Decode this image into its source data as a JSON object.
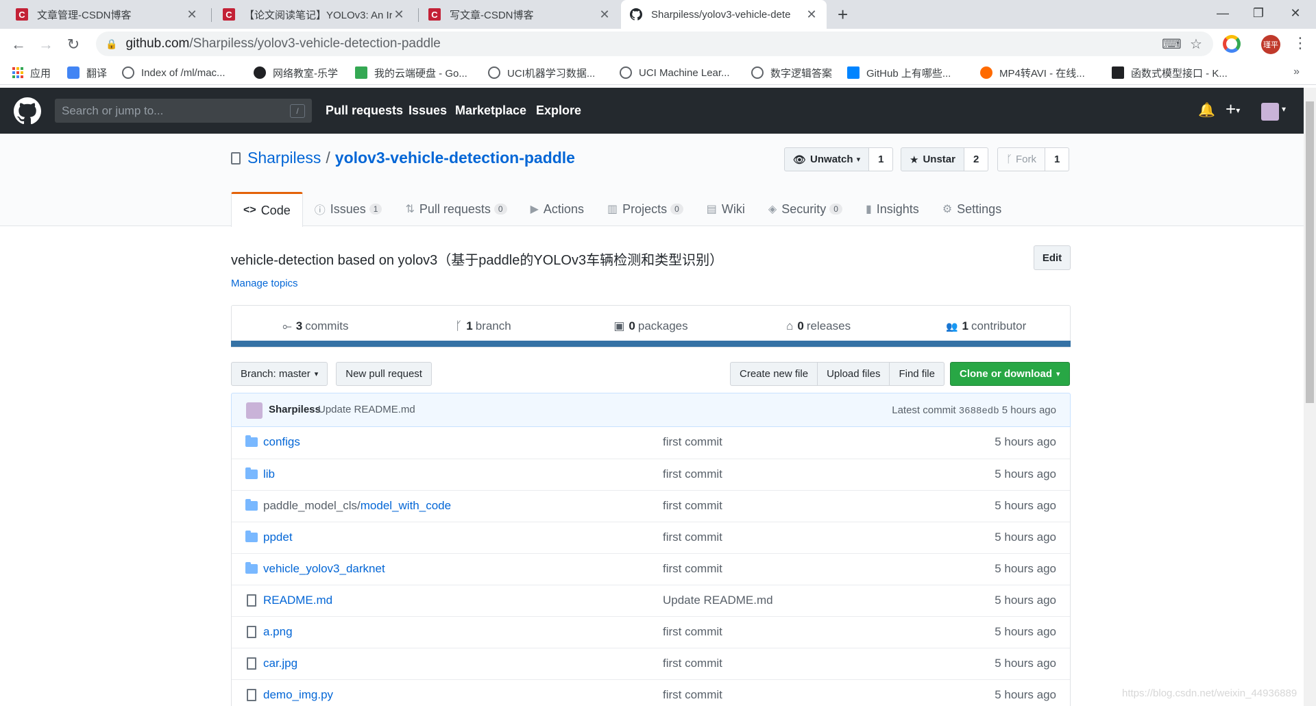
{
  "browser": {
    "tabs": [
      {
        "title": "文章管理-CSDN博客",
        "icon": "csdn-icon"
      },
      {
        "title": "【论文阅读笔记】YOLOv3: An Ir",
        "icon": "csdn-icon"
      },
      {
        "title": "写文章-CSDN博客",
        "icon": "csdn-icon"
      },
      {
        "title": "Sharpiless/yolov3-vehicle-dete",
        "icon": "github-icon",
        "active": true
      }
    ],
    "address": {
      "host": "github.com",
      "path": "/Sharpiless/yolov3-vehicle-detection-paddle"
    },
    "profile_badge": "瑾平",
    "bookmarks": [
      {
        "label": "应用",
        "color": "#ea4335"
      },
      {
        "label": "翻译",
        "color": "#4285f4"
      },
      {
        "label": "Index of /ml/mac...",
        "color": "#5f6368"
      },
      {
        "label": "网络教室-乐学",
        "color": "#202124"
      },
      {
        "label": "我的云端硬盘 - Go...",
        "color": "#34a853"
      },
      {
        "label": "UCI机器学习数据...",
        "color": "#5f6368"
      },
      {
        "label": "UCI Machine Lear...",
        "color": "#5f6368"
      },
      {
        "label": "数字逻辑答案",
        "color": "#5f6368"
      },
      {
        "label": "GitHub 上有哪些...",
        "color": "#0084ff"
      },
      {
        "label": "MP4转AVI - 在线...",
        "color": "#ff6a00"
      },
      {
        "label": "函数式模型接口 - K...",
        "color": "#202124"
      }
    ],
    "bookmarks_more": "»"
  },
  "github": {
    "search_placeholder": "Search or jump to...",
    "search_key": "/",
    "nav": [
      "Pull requests",
      "Issues",
      "Marketplace",
      "Explore"
    ]
  },
  "repo": {
    "owner": "Sharpiless",
    "separator": "/",
    "name": "yolov3-vehicle-detection-paddle",
    "watch": {
      "label": "Unwatch",
      "count": "1"
    },
    "star": {
      "label": "Unstar",
      "count": "2"
    },
    "fork": {
      "label": "Fork",
      "count": "1"
    },
    "tabs": [
      {
        "label": "Code",
        "icon": "<>",
        "counter": ""
      },
      {
        "label": "Issues",
        "icon": "ⓘ",
        "counter": "1"
      },
      {
        "label": "Pull requests",
        "icon": "⇅",
        "counter": "0"
      },
      {
        "label": "Actions",
        "icon": "▶",
        "counter": ""
      },
      {
        "label": "Projects",
        "icon": "▥",
        "counter": "0"
      },
      {
        "label": "Wiki",
        "icon": "▤",
        "counter": ""
      },
      {
        "label": "Security",
        "icon": "◈",
        "counter": "0"
      },
      {
        "label": "Insights",
        "icon": "▮",
        "counter": ""
      },
      {
        "label": "Settings",
        "icon": "⚙",
        "counter": ""
      }
    ],
    "description": "vehicle-detection based on yolov3（基于paddle的YOLOv3车辆检测和类型识别）",
    "edit_label": "Edit",
    "manage_topics": "Manage topics",
    "summary": [
      {
        "icon": "⟜",
        "num": "3",
        "label": "commits"
      },
      {
        "icon": "ᚴ",
        "num": "1",
        "label": "branch"
      },
      {
        "icon": "▣",
        "num": "0",
        "label": "packages"
      },
      {
        "icon": "⌂",
        "num": "0",
        "label": "releases"
      },
      {
        "icon": "👥",
        "num": "1",
        "label": "contributor"
      }
    ],
    "language_color": "#3572a5",
    "branch_label": "Branch: master",
    "new_pr_label": "New pull request",
    "file_actions": [
      "Create new file",
      "Upload files",
      "Find file"
    ],
    "clone_label": "Clone or download",
    "latest_commit": {
      "author": "Sharpiless",
      "message": "Update README.md",
      "prefix": "Latest commit",
      "sha": "3688edb",
      "age": "5 hours ago"
    },
    "files": [
      {
        "type": "dir",
        "name": "configs",
        "sub": "",
        "message": "first commit",
        "age": "5 hours ago"
      },
      {
        "type": "dir",
        "name": "lib",
        "sub": "",
        "message": "first commit",
        "age": "5 hours ago"
      },
      {
        "type": "dir",
        "name": "model_with_code",
        "sub": "paddle_model_cls/",
        "message": "first commit",
        "age": "5 hours ago"
      },
      {
        "type": "dir",
        "name": "ppdet",
        "sub": "",
        "message": "first commit",
        "age": "5 hours ago"
      },
      {
        "type": "dir",
        "name": "vehicle_yolov3_darknet",
        "sub": "",
        "message": "first commit",
        "age": "5 hours ago"
      },
      {
        "type": "file",
        "name": "README.md",
        "sub": "",
        "message": "Update README.md",
        "age": "5 hours ago"
      },
      {
        "type": "file",
        "name": "a.png",
        "sub": "",
        "message": "first commit",
        "age": "5 hours ago"
      },
      {
        "type": "file",
        "name": "car.jpg",
        "sub": "",
        "message": "first commit",
        "age": "5 hours ago"
      },
      {
        "type": "file",
        "name": "demo_img.py",
        "sub": "",
        "message": "first commit",
        "age": "5 hours ago"
      }
    ]
  },
  "watermark": "https://blog.csdn.net/weixin_44936889"
}
